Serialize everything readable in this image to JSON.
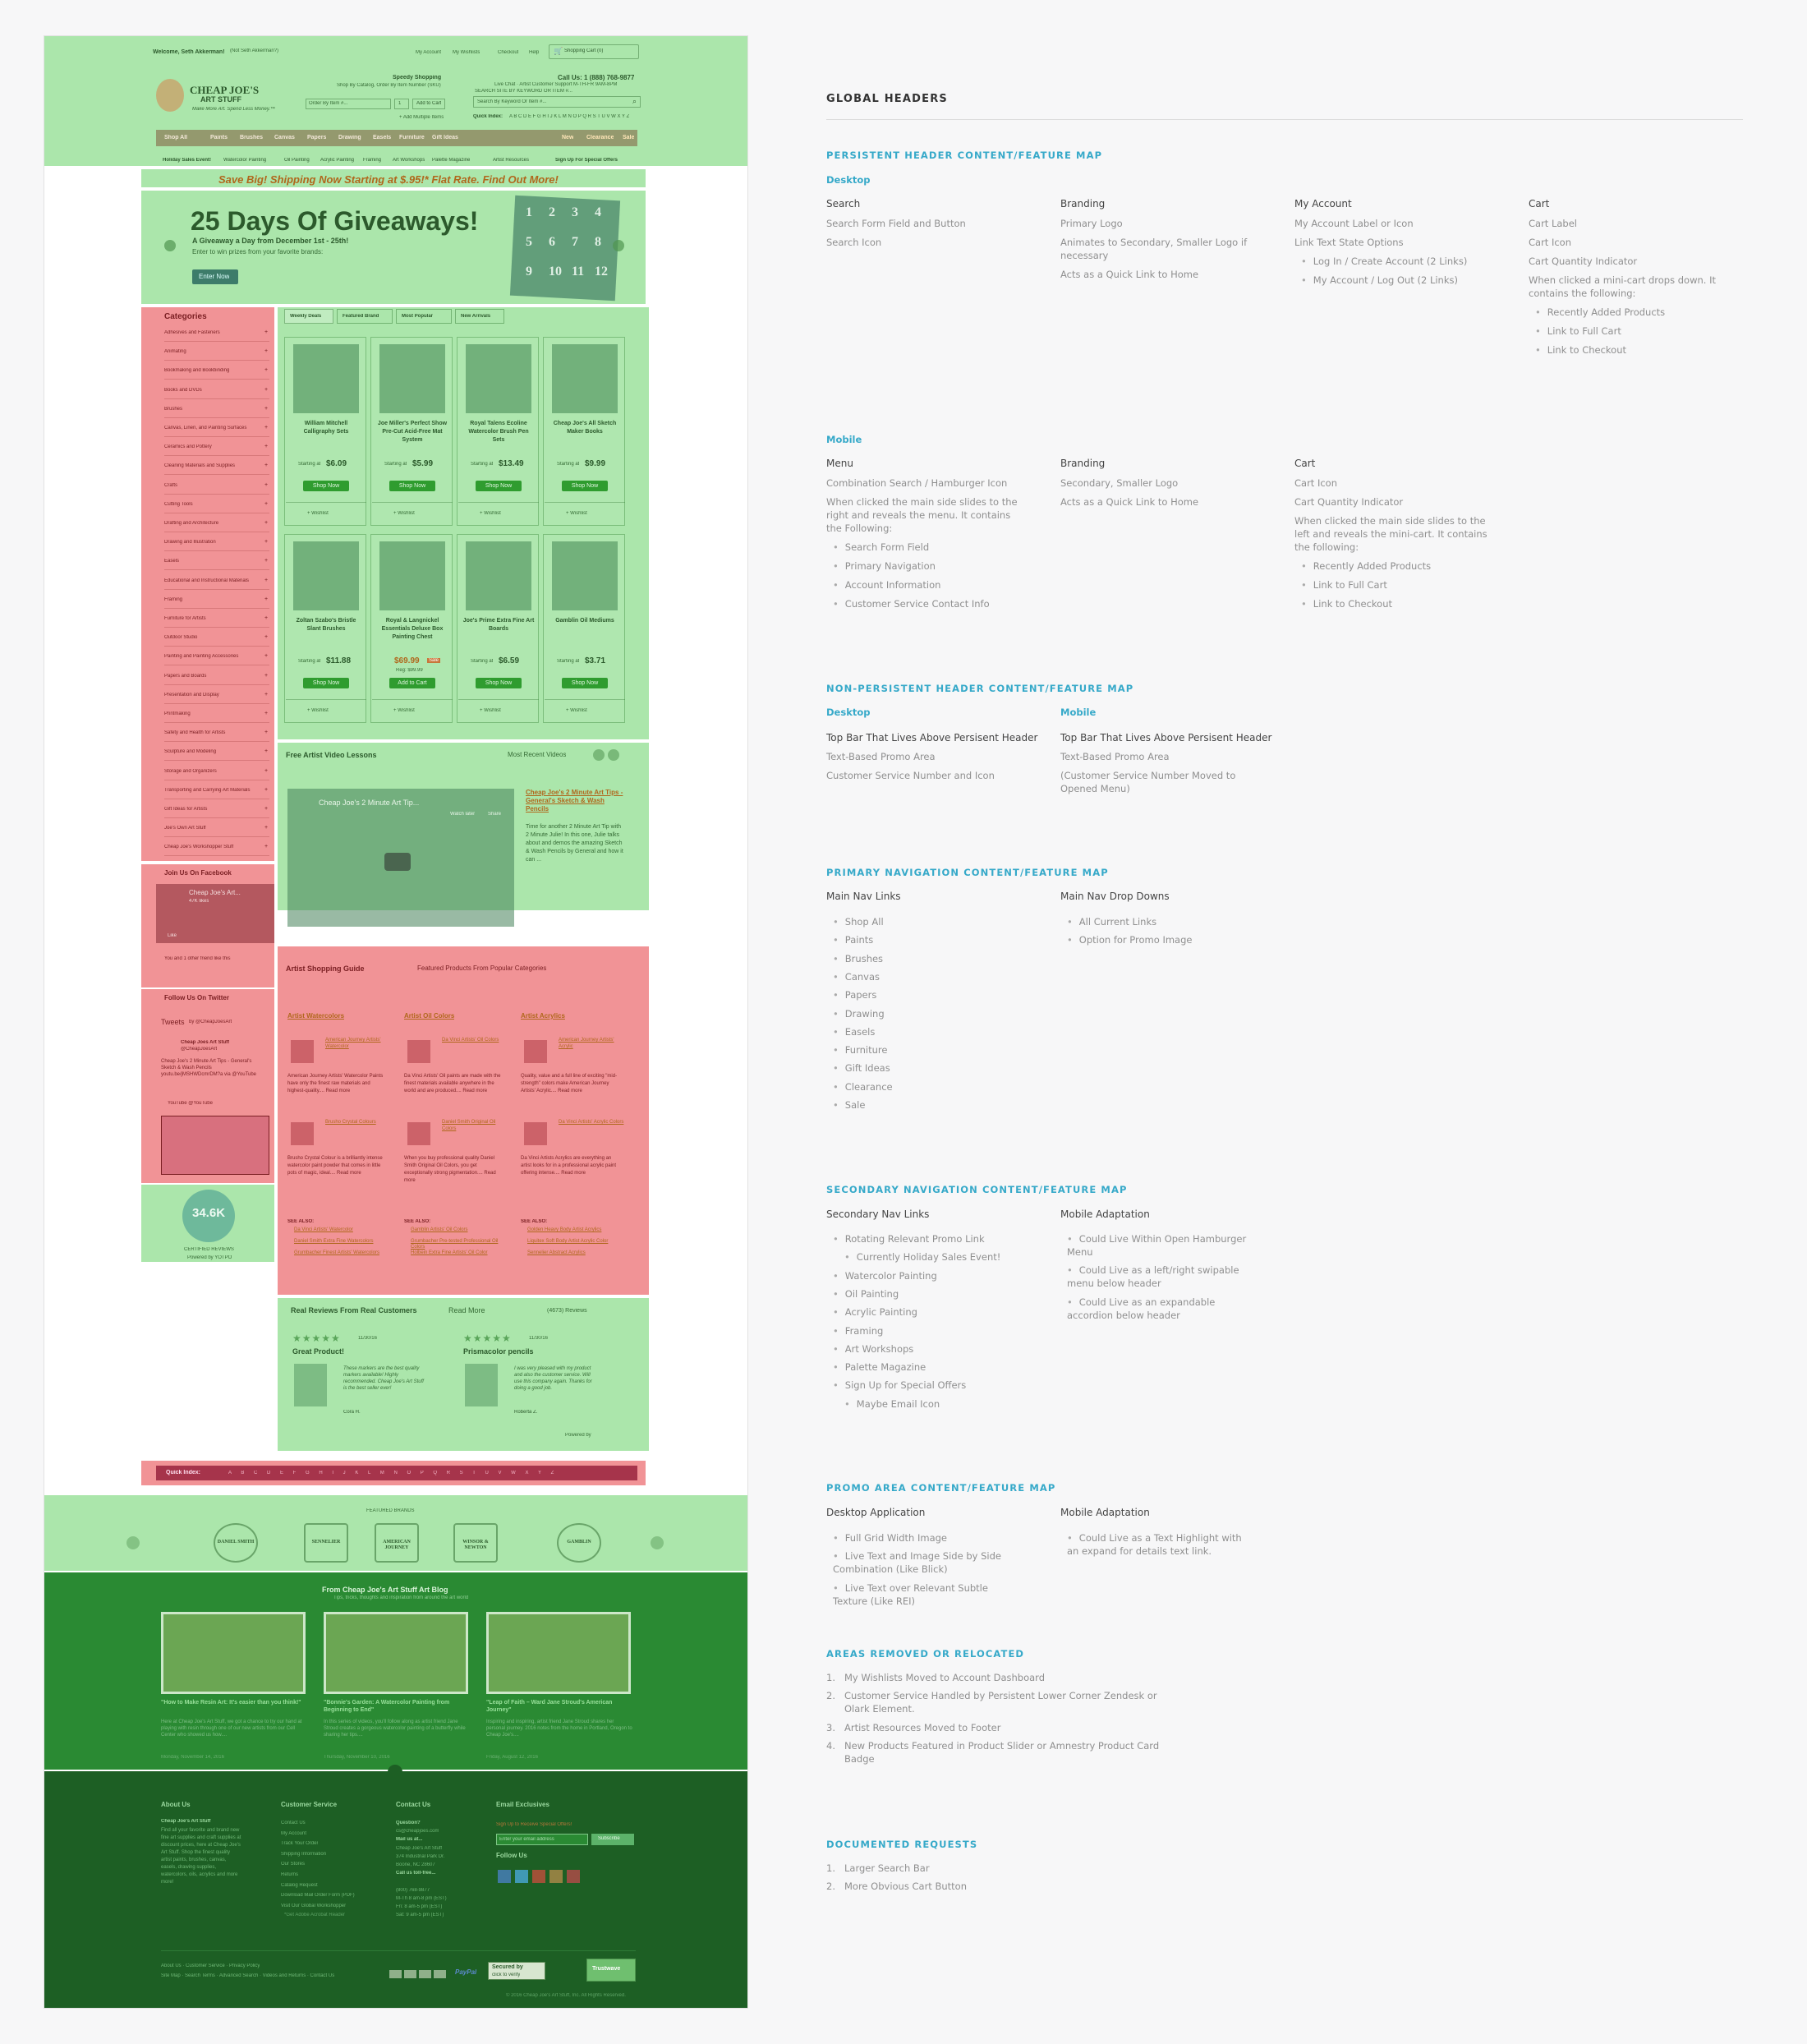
{
  "mock": {
    "topbar": {
      "welcome": "Welcome, Seth Akkerman!",
      "not_you": "(Not Seth Akkerman?)",
      "links": [
        "My Account",
        "My Wishlists",
        "Checkout",
        "Help"
      ],
      "cart": "Shopping Cart (0)"
    },
    "header": {
      "logo_line1": "CHEAP JOE'S",
      "logo_line2": "ART STUFF",
      "tagline": "Make More Art. Spend Less Money.™",
      "speedy_title": "Speedy Shopping",
      "speedy_sub": "Shop By Catalog, Order By Item Number (SKU)",
      "item_placeholder": "Order By Item #...",
      "qty": "1",
      "add_to_cart": "Add to Cart",
      "add_multiple": "+ Add Multiple Items",
      "call_us": "Call Us: 1 (888) 768-9877",
      "live_chat": "Live Chat  ·  Artist Customer Support  M-TH-FR 9AM-8PM",
      "search_by": "SEARCH SITE BY KEYWORD OR ITEM #...",
      "search_placeholder": "Search By Keyword Or Item #...",
      "quick_index_label": "Quick Index:",
      "quick_index": "A B C D E F G H I J K L M N O P Q R S T U V W X Y Z"
    },
    "nav": [
      "Shop All",
      "Paints",
      "Brushes",
      "Canvas",
      "Papers",
      "Drawing",
      "Easels",
      "Furniture",
      "Gift Ideas"
    ],
    "nav_right": [
      "New",
      "Clearance",
      "Sale"
    ],
    "subnav": [
      "Holiday Sales Event!",
      "Watercolor Painting",
      "Oil Painting",
      "Acrylic Painting",
      "Framing",
      "Art Workshops",
      "Palette Magazine",
      "Artist Resources"
    ],
    "subnav_signup": "Sign Up For Special Offers",
    "promo_strip": "Save Big! Shipping Now Starting at $.95!* Flat Rate. Find Out More!",
    "hero": {
      "title": "25 Days Of Giveaways!",
      "subtitle": "A Giveaway a Day from December 1st - 25th!",
      "sub2": "Enter to win prizes from your favorite brands:",
      "cta": "Enter Now",
      "calendar": [
        "1",
        "2",
        "3",
        "4",
        "5",
        "6",
        "7",
        "8",
        "9",
        "10",
        "11",
        "12"
      ]
    },
    "categories": {
      "title": "Categories",
      "items": [
        "Adhesives and Fasteners",
        "Animating",
        "Bookmaking and Bookbinding",
        "Books and DVDs",
        "Brushes",
        "Canvas, Linen, and Painting Surfaces",
        "Ceramics and Pottery",
        "Cleaning Materials and Supplies",
        "Crafts",
        "Cutting Tools",
        "Drafting and Architecture",
        "Drawing and Illustration",
        "Easels",
        "Educational and Instructional Materials",
        "Framing",
        "Furniture for Artists",
        "Outdoor Studio",
        "Painting and Painting Accessories",
        "Papers and Boards",
        "Presentation and Display",
        "Printmaking",
        "Safety and Health for Artists",
        "Sculpture and Modeling",
        "Storage and Organizers",
        "Transporting and Carrying Art Materials",
        "Gift Ideas for Artists",
        "Joe's Own Art Stuff",
        "Cheap Joe's Workshopper Stuff"
      ]
    },
    "tabs": [
      "Weekly Deals",
      "Featured Brand",
      "Most Popular",
      "New Arrivals"
    ],
    "products": [
      {
        "name": "William Mitchell Calligraphy Sets",
        "starting": "Starting at",
        "price": "$6.09",
        "btn": "Shop Now"
      },
      {
        "name": "Joe Miller's Perfect Show Pre-Cut Acid-Free Mat System",
        "starting": "Starting at",
        "price": "$5.99",
        "btn": "Shop Now"
      },
      {
        "name": "Royal Talens Ecoline Watercolor Brush Pen Sets",
        "starting": "Starting at",
        "price": "$13.49",
        "btn": "Shop Now"
      },
      {
        "name": "Cheap Joe's All Sketch Maker Books",
        "starting": "Starting at",
        "price": "$9.99",
        "btn": "Shop Now"
      },
      {
        "name": "Zoltan Szabo's Bristle Slant Brushes",
        "starting": "Starting at",
        "price": "$11.88",
        "btn": "Shop Now"
      },
      {
        "name": "Royal & Langnickel Essentials Deluxe Box Painting Chest",
        "starting": "",
        "price": "$69.99",
        "btn": "Add to Cart",
        "reg": "Reg: $99.99",
        "badge": "Sale"
      },
      {
        "name": "Joe's Prime Extra Fine Art Boards",
        "starting": "Starting at",
        "price": "$6.59",
        "btn": "Shop Now"
      },
      {
        "name": "Gamblin Oil Mediums",
        "starting": "Starting at",
        "price": "$3.71",
        "btn": "Shop Now"
      }
    ],
    "wishlist": "+ Wishlist",
    "video": {
      "title": "Free Artist Video Lessons",
      "right": "Most Recent Videos",
      "player_title": "Cheap Joe's 2 Minute Art Tip...",
      "watch_later": "Watch later",
      "share": "Share",
      "link": "Cheap Joe's 2 Minute Art Tips - General's Sketch & Wash Pencils",
      "desc": "Time for another 2 Minute Art Tip with 2 Minute Julie! In this one, Julie talks about and demos the amazing Sketch & Wash Pencils by General and how it can ..."
    },
    "facebook": {
      "title": "Join Us On Facebook",
      "page": "Cheap Joe's Art...",
      "likes": "47K likes",
      "like_btn": "Like",
      "friends": "You and 1 other friend like this"
    },
    "twitter": {
      "title": "Follow Us On Twitter",
      "tweets": "Tweets",
      "by": "by @CheapJoesArt",
      "account": "Cheap Joes Art Stuff",
      "handle": "@CheapJoesArt",
      "text": "Cheap Joe's 2 Minute Art Tips - General's Sketch & Wash Pencils youtu.be/jMSHWDcmrDM?a via @YouTube",
      "yt": "YouTube  @YouTube"
    },
    "badge": {
      "count": "34.6K",
      "label": "CERTIFIED REVIEWS",
      "powered": "Powered by YOTPO"
    },
    "guide": {
      "title": "Artist Shopping Guide",
      "right": "Featured Products From Popular Categories",
      "cols": [
        {
          "head": "Artist Watercolors",
          "p1": "American Journey Artists' Watercolor",
          "d1": "American Journey Artists' Watercolor Paints have only the finest raw materials and highest-quality....  Read more",
          "p2": "Brusho Crystal Colours",
          "d2": "Brusho Crystal Colour is a brilliantly intense watercolor paint powder that comes in little pots of magic, ideal....  Read more",
          "see": "SEE ALSO:",
          "links": [
            "Da Vinci Artists' Watercolor",
            "Daniel Smith Extra Fine Watercolors",
            "Grumbacher Finest Artists' Watercolors"
          ]
        },
        {
          "head": "Artist Oil Colors",
          "p1": "Da Vinci Artists' Oil Colors",
          "d1": "Da Vinci Artists' Oil paints are made with the finest materials available anywhere in the world and are produced....  Read more",
          "p2": "Daniel Smith Original Oil Colors",
          "d2": "When you buy professional quality Daniel Smith Original Oil Colors, you get exceptionally strong pigmentation....  Read more",
          "see": "SEE ALSO:",
          "links": [
            "Gamblin Artists' Oil Colors",
            "Grumbacher Pre-tested Professional Oil Colors",
            "Holbein Extra Fine Artists' Oil Color"
          ]
        },
        {
          "head": "Artist Acrylics",
          "p1": "American Journey Artists' Acrylic",
          "d1": "Quality, value and a full line of exciting \"mid-strength\" colors make American Journey Artists' Acrylic....  Read more",
          "p2": "Da Vinci Artists' Acrylic Colors",
          "d2": "Da Vinci Artists Acrylics are everything an artist looks for in a professional acrylic paint offering intense....  Read more",
          "see": "SEE ALSO:",
          "links": [
            "Golden Heavy Body Artist Acrylics",
            "Liquitex Soft Body Artist Acrylic Color",
            "Sennelier Abstract Acrylics"
          ]
        }
      ]
    },
    "reviews": {
      "title": "Real Reviews From Real Customers",
      "read_more": "Read More",
      "count": "(4673) Reviews",
      "items": [
        {
          "title": "Great Product!",
          "date": "11/30/16",
          "text": "These markers are the best quality markers available! Highly recommended. Cheap Joe's Art Stuff is the best seller ever!",
          "author": "Cora H."
        },
        {
          "title": "Prismacolor pencils",
          "date": "11/30/16",
          "text": "I was very pleased with my product and also the customer service. Will use this company again. Thanks for doing a good job.",
          "author": "Roberta Z."
        }
      ],
      "powered": "Powered by"
    },
    "quick_index": {
      "label": "Quick Index:",
      "letters": "A B C D E F G H I J K L M N O P Q R S T U V W X Y Z"
    },
    "brands": {
      "label": "FEATURED BRANDS",
      "items": [
        "DANIEL SMITH",
        "SENNELIER",
        "AMERICAN JOURNEY",
        "WINSOR & NEWTON",
        "GAMBLIN"
      ]
    },
    "blog": {
      "title": "From Cheap Joe's Art Stuff Art Blog",
      "sub": "Tips, tricks, thoughts and inspiration from around the art world",
      "posts": [
        {
          "title": "\"How to Make Resin Art: It's easier than you think!\"",
          "text": "Here at Cheap Joe's Art Stuff, we got a chance to try our hand at playing with resin through one of our new artists from our Cell Center who showed us how....",
          "date": "Monday, November 14, 2016"
        },
        {
          "title": "\"Bonnie's Garden: A Watercolor Painting from Beginning to End\"",
          "text": "In this series of videos, you'll follow along as artist friend Jane Stroud creates a gorgeous watercolor painting of a butterfly while sharing her tips....",
          "date": "Thursday, November 10, 2016"
        },
        {
          "title": "\"Leap of Faith – Ward Jane Stroud's American Journey\"",
          "text": "Inspiring and inspiring, artist friend Jane Stroud shares her personal journey. 2016 notes from the home in Portland, Oregon to Cheap Joe's....",
          "date": "Friday, August 12, 2016"
        }
      ]
    },
    "footer": {
      "about": {
        "title": "About Us",
        "name": "Cheap Joe's Art Stuff",
        "text": "Find all your favorite and brand new fine art supplies and craft supplies at discount prices, here at Cheap Joe's Art Stuff. Shop the finest quality artist paints, brushes, canvas, easels, drawing supplies, watercolors, oils, acrylics and more more!"
      },
      "service": {
        "title": "Customer Service",
        "links": [
          "Contact Us",
          "My Account",
          "Track Your Order",
          "Shipping Information",
          "Our Stores",
          "Returns",
          "Catalog Request",
          "Download Mail Order Form (PDF)",
          "Visit Our Global Workshopper"
        ],
        "note": "*Get Adobe Acrobat Reader"
      },
      "contact": {
        "title": "Contact Us",
        "lines": [
          "Question?",
          "cs@cheapjoes.com",
          "Mail us at...",
          "Cheap Joe's Art Stuff",
          "374 Industrial Park Dr.",
          "Boone, NC 28607",
          "Call us toll-free...",
          "",
          "(800) 768-9877",
          "M-Th 8 am-8 pm (EST)",
          "Fri: 8 am-5 pm (EST)",
          "Sat: 9 am-5 pm (EST)"
        ]
      },
      "email": {
        "title": "Email Exclusives",
        "sub": "Sign Up to Receive Special Offers!",
        "placeholder": "Enter your email address",
        "button": "Subscribe",
        "follow": "Follow Us"
      },
      "bottom_links1": "About Us  ·  Customer Service  ·  Privacy Policy",
      "bottom_links2": "Site Map  ·  Search Terms  ·  Advanced Search  ·  Videos and Returns  ·  Contact Us",
      "secured": "Secured by",
      "secured_sub": "click to verify",
      "trustwave": "Trustwave",
      "copyright": "© 2016 Cheap Joe's Art Stuff, Inc. All Rights Reserved."
    }
  },
  "notes": {
    "title": "GLOBAL HEADERS",
    "persistent": {
      "heading": "PERSISTENT HEADER CONTENT/FEATURE MAP",
      "desktop_label": "Desktop",
      "desktop": [
        {
          "head": "Search",
          "items": [
            "Search Form Field and Button",
            "Search Icon"
          ]
        },
        {
          "head": "Branding",
          "items": [
            "Primary Logo",
            "Animates to Secondary, Smaller Logo if necessary",
            "Acts as a Quick Link to Home"
          ]
        },
        {
          "head": "My Account",
          "items": [
            "My Account Label or Icon",
            "Link Text State Options"
          ],
          "bullets": [
            "Log In / Create Account (2 Links)",
            "My Account / Log Out (2 Links)"
          ]
        },
        {
          "head": "Cart",
          "items": [
            "Cart Label",
            "Cart Icon",
            "Cart Quantity Indicator",
            "When clicked a mini-cart drops down. It contains the following:"
          ],
          "bullets": [
            "Recently Added Products",
            "Link to Full Cart",
            "Link to Checkout"
          ]
        }
      ],
      "mobile_label": "Mobile",
      "mobile": [
        {
          "head": "Menu",
          "items": [
            "Combination Search / Hamburger Icon",
            "When clicked the main side slides to the right and reveals the menu. It contains the Following:"
          ],
          "bullets": [
            "Search Form Field",
            "Primary Navigation",
            "Account Information",
            "Customer Service Contact Info"
          ]
        },
        {
          "head": "Branding",
          "items": [
            "Secondary, Smaller Logo",
            "Acts as a Quick Link to Home"
          ]
        },
        {
          "head": "Cart",
          "items": [
            "Cart Icon",
            "Cart Quantity Indicator",
            "When clicked the main side slides to the left and reveals the mini-cart. It contains the following:"
          ],
          "bullets": [
            "Recently Added Products",
            "Link to Full Cart",
            "Link to Checkout"
          ]
        }
      ]
    },
    "nonpersistent": {
      "heading": "NON-PERSISTENT HEADER CONTENT/FEATURE MAP",
      "desktop_label": "Desktop",
      "desktop_head": "Top Bar That Lives Above Persisent Header",
      "desktop_items": [
        "Text-Based Promo Area",
        "Customer Service Number and Icon"
      ],
      "mobile_label": "Mobile",
      "mobile_head": "Top Bar That Lives Above Persisent Header",
      "mobile_items": [
        "Text-Based Promo Area",
        "(Customer Service Number Moved to Opened Menu)"
      ]
    },
    "primary": {
      "heading": "PRIMARY NAVIGATION CONTENT/FEATURE MAP",
      "links_head": "Main Nav Links",
      "links": [
        "Shop All",
        "Paints",
        "Brushes",
        "Canvas",
        "Papers",
        "Drawing",
        "Easels",
        "Furniture",
        "Gift Ideas",
        "Clearance",
        "Sale"
      ],
      "dropdowns_head": "Main Nav Drop Downs",
      "dropdowns": [
        "All Current Links",
        "Option for Promo Image"
      ]
    },
    "secondary": {
      "heading": "SECONDARY NAVIGATION CONTENT/FEATURE MAP",
      "links_head": "Secondary Nav Links",
      "links": [
        "Rotating Relevant Promo Link",
        "Currently Holiday Sales Event!",
        "Watercolor Painting",
        "Oil Painting",
        "Acrylic Painting",
        "Framing",
        "Art Workshops",
        "Palette Magazine",
        "Sign Up for Special Offers",
        "Maybe Email Icon"
      ],
      "mobile_head": "Mobile Adaptation",
      "mobile": [
        "Could Live Within Open Hamburger Menu",
        "Could Live as a left/right swipable menu below header",
        "Could Live as an expandable accordion below header"
      ]
    },
    "promo": {
      "heading": "PROMO AREA CONTENT/FEATURE MAP",
      "desktop_head": "Desktop Application",
      "desktop": [
        "Full Grid Width Image",
        "Live Text and Image Side by Side Combination (Like Blick)",
        "Live Text over Relevant Subtle Texture (Like REI)"
      ],
      "mobile_head": "Mobile Adaptation",
      "mobile": [
        "Could Live as a Text Highlight with an expand for details text link."
      ]
    },
    "removed": {
      "heading": "AREAS REMOVED OR RELOCATED",
      "items": [
        "My Wishlists Moved to Account Dashboard",
        "Customer Service Handled by Persistent Lower Corner Zendesk or Olark Element.",
        "Artist Resources Moved to Footer",
        "New Products Featured in Product Slider or Amnestry Product Card Badge"
      ]
    },
    "requests": {
      "heading": "DOCUMENTED REQUESTS",
      "items": [
        "Larger Search Bar",
        "More Obvious Cart Button"
      ]
    },
    "colors": {
      "accent": "#36a9c9",
      "overlay_green": "#78d678",
      "overlay_red": "#eb696e",
      "footer_green": "#1d6b26"
    }
  }
}
